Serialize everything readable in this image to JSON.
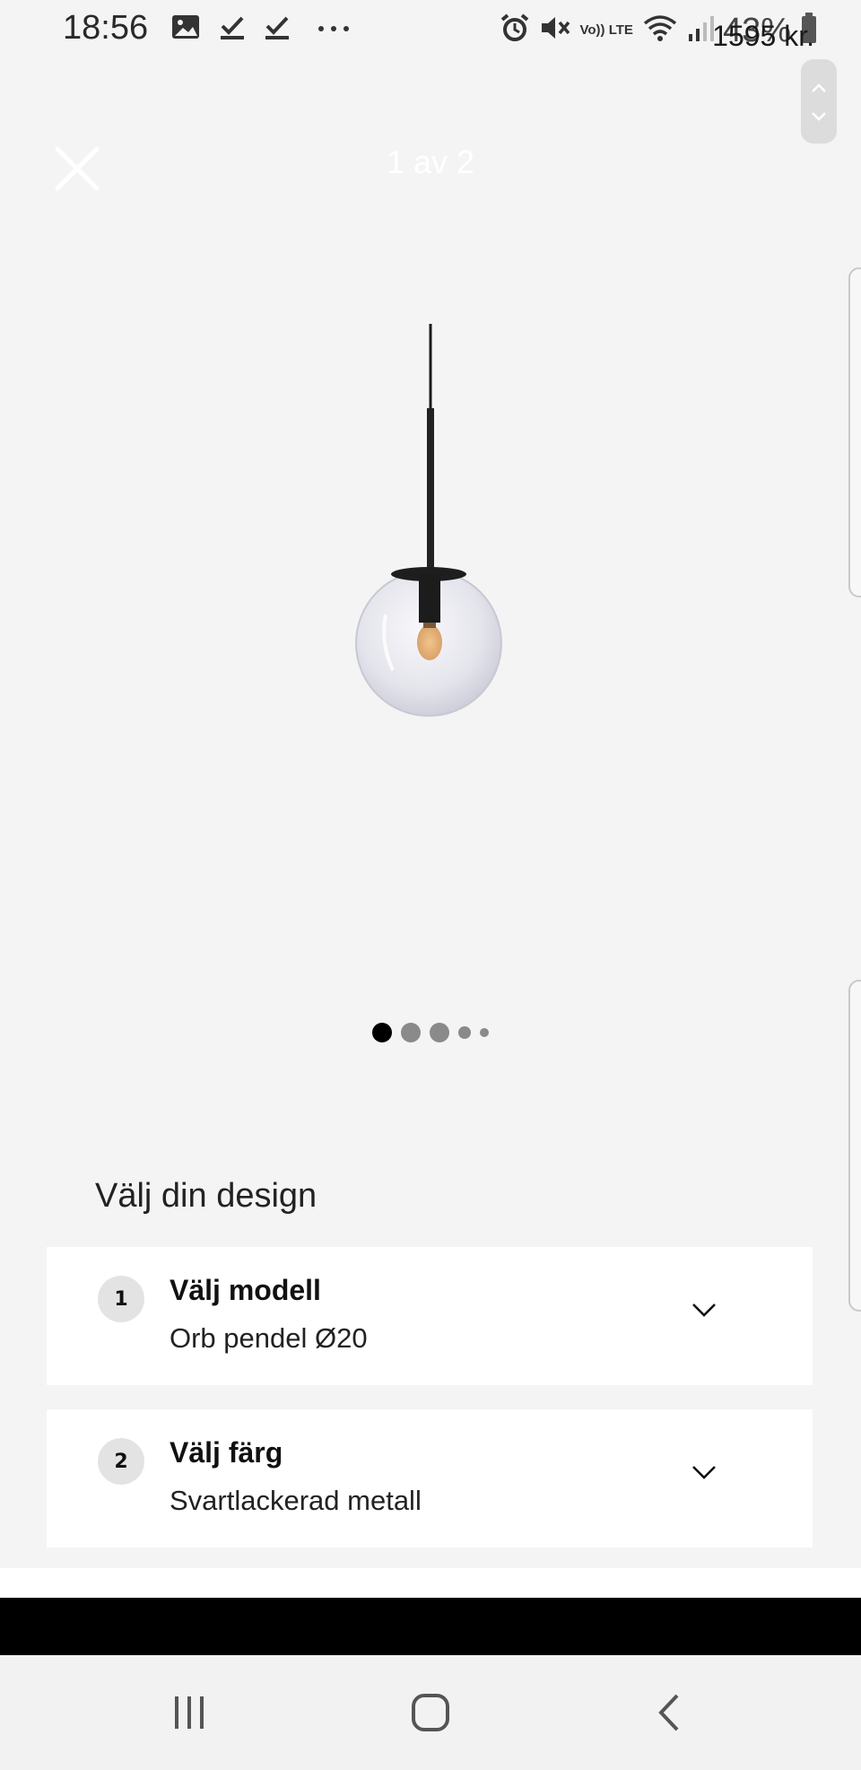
{
  "status_bar": {
    "time": "18:56",
    "battery_percent": "43%",
    "icons": [
      "image-icon",
      "check-icon",
      "check-icon",
      "more-icon",
      "alarm-icon",
      "mute-icon",
      "volte-icon",
      "wifi-icon",
      "signal-icon",
      "battery-icon"
    ],
    "volte_label": "Vo)) LTE"
  },
  "price_overlay": "1595 kr.",
  "gallery": {
    "counter": "1 av 2",
    "dots_count": 5,
    "active_dot": 0
  },
  "design": {
    "title": "Välj din design",
    "steps": [
      {
        "number": "1",
        "label": "Välj modell",
        "value": "Orb pendel Ø20"
      },
      {
        "number": "2",
        "label": "Välj färg",
        "value": "Svartlackerad metall"
      }
    ]
  },
  "colors": {
    "background": "#f4f4f4",
    "card": "#ffffff",
    "step_badge": "#e3e3e3",
    "dot_active": "#000000",
    "dot_inactive": "#8a8a8a"
  }
}
